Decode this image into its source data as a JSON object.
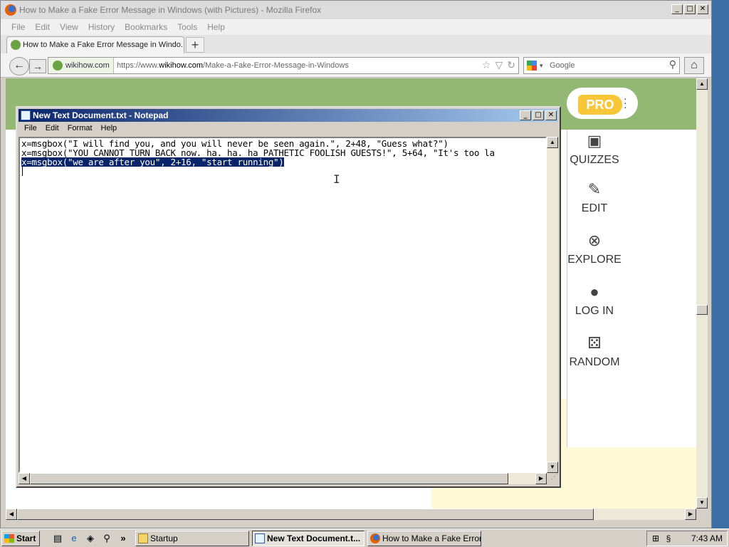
{
  "firefox": {
    "window_title": "How to Make a Fake Error Message in Windows (with Pictures) - Mozilla Firefox",
    "menu": [
      "File",
      "Edit",
      "View",
      "History",
      "Bookmarks",
      "Tools",
      "Help"
    ],
    "tab_title": "How to Make a Fake Error Message in Windo...",
    "new_tab": "+",
    "site_identity": "wikihow.com",
    "url_prefix": "https://www.",
    "url_domain": "wikihow.com",
    "url_path": "/Make-a-Fake-Error-Message-in-Windows",
    "search_placeholder": "Google"
  },
  "page": {
    "pro_label": "PRO",
    "nav": [
      {
        "label": "QUIZZES",
        "icon": "quizzes-icon"
      },
      {
        "label": "EDIT",
        "icon": "pencil-icon"
      },
      {
        "label": "EXPLORE",
        "icon": "compass-icon"
      },
      {
        "label": "LOG IN",
        "icon": "user-icon"
      },
      {
        "label": "RANDOM",
        "icon": "dice-icon"
      }
    ]
  },
  "notepad": {
    "title": "New Text Document.txt - Notepad",
    "menu": [
      "File",
      "Edit",
      "Format",
      "Help"
    ],
    "lines": [
      "x=msgbox(\"I will find you, and you will never be seen again.\", 2+48, \"Guess what?\")",
      "x=msgbox(\"YOU CANNOT TURN BACK now. ha. ha. ha PATHETIC FOOLISH GUESTS!\", 5+64, \"It's too la",
      "x=msgbox(\"we are after you\", 2+16, \"start running\")"
    ]
  },
  "taskbar": {
    "start": "Start",
    "chevron": "»",
    "tasks": [
      {
        "label": "Startup",
        "icon": "folder-icon"
      },
      {
        "label": "New Text Document.t...",
        "icon": "notepad-icon"
      },
      {
        "label": "How to Make a Fake Error...",
        "icon": "firefox-icon"
      }
    ],
    "clock": "7:43 AM"
  },
  "colors": {
    "wikihow_green": "#93b874",
    "pro_yellow": "#f7c739",
    "notepad_title": "#0a246a",
    "cream": "#fff9d8"
  }
}
